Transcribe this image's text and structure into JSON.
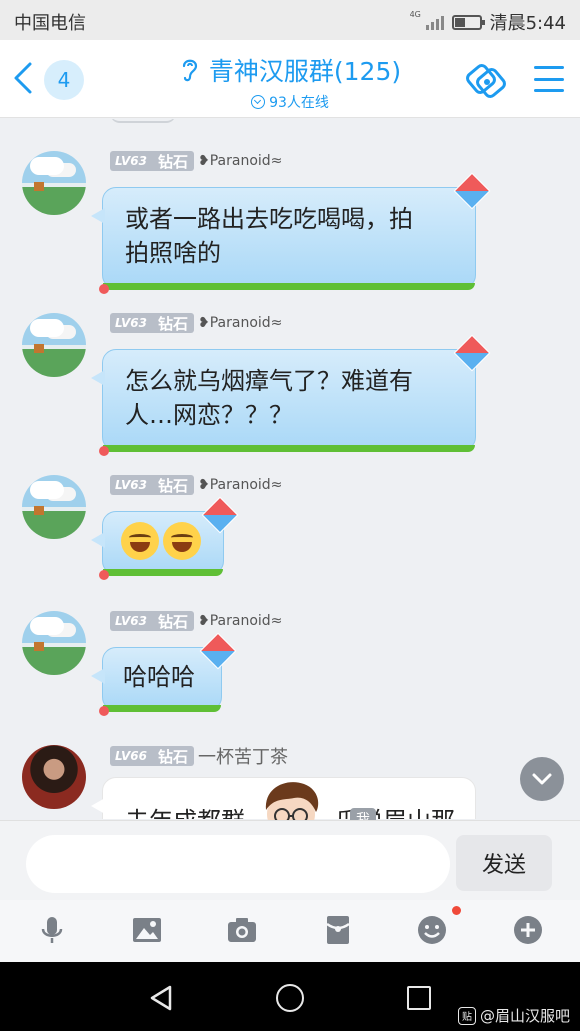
{
  "status_bar": {
    "carrier": "中国电信",
    "network": "4G",
    "clock": "清晨5:44"
  },
  "header": {
    "unread_count": "4",
    "title": "青神汉服群(125)",
    "online_text": "93人在线"
  },
  "messages": [
    {
      "level": "LV63",
      "rank": "钻石",
      "nick": "❥Paranoid≈",
      "text_lines": [
        "或者一路出去吃吃喝喝，拍",
        "拍照啥的"
      ]
    },
    {
      "level": "LV63",
      "rank": "钻石",
      "nick": "❥Paranoid≈",
      "text_lines": [
        "怎么就乌烟瘴气了？难道有",
        "人…网恋？？？"
      ]
    },
    {
      "level": "LV63",
      "rank": "钻石",
      "nick": "❥Paranoid≈",
      "emojis": [
        "laughing-tears",
        "laughing-tears"
      ]
    },
    {
      "level": "LV63",
      "rank": "钻石",
      "nick": "❥Paranoid≈",
      "text_lines": [
        "哈哈哈"
      ]
    },
    {
      "level": "LV66",
      "rank": "钻石",
      "nick": "一杯苦丁茶",
      "text_lines": [
        "去年成都群",
        "瓜说眉山那"
      ]
    }
  ],
  "me_tag": "我",
  "input": {
    "placeholder": ""
  },
  "send_label": "发送",
  "toolbar_icons": [
    "microphone-icon",
    "image-icon",
    "camera-icon",
    "red-packet-icon",
    "emoji-icon",
    "plus-icon"
  ],
  "watermark": {
    "badge": "贴",
    "text": "@眉山汉服吧"
  },
  "colors": {
    "accent": "#1d9bf0",
    "bubble": "#a9d8f7",
    "grass": "#5fbf35",
    "notify_dot": "#f04a3a"
  }
}
